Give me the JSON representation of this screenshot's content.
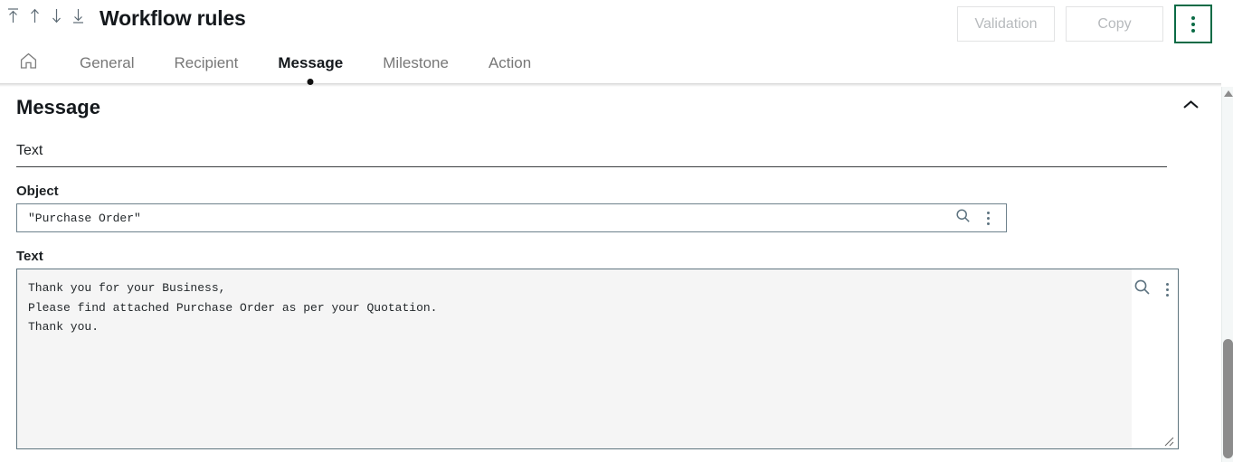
{
  "window": {
    "title": "Workflow rules"
  },
  "record_nav": [
    {
      "name": "first-record",
      "icon": "arrow-up-to-line-icon"
    },
    {
      "name": "previous-record",
      "icon": "arrow-up-icon"
    },
    {
      "name": "next-record",
      "icon": "arrow-down-icon"
    },
    {
      "name": "last-record",
      "icon": "arrow-down-to-line-icon"
    }
  ],
  "toolbar": {
    "validation_label": "Validation",
    "copy_label": "Copy",
    "overflow_icon": "kebab-menu-icon",
    "overflow_accent": "#0b6b46",
    "disabled_text_color": "#b7babd"
  },
  "tabs": {
    "home_icon": "home-icon",
    "items": [
      {
        "label": "General",
        "active": false
      },
      {
        "label": "Recipient",
        "active": false
      },
      {
        "label": "Message",
        "active": true
      },
      {
        "label": "Milestone",
        "active": false
      },
      {
        "label": "Action",
        "active": false
      }
    ]
  },
  "section": {
    "title": "Message",
    "collapse_icon": "chevron-up-icon",
    "expanded": true
  },
  "group": {
    "label": "Text"
  },
  "fields": {
    "object": {
      "label": "Object",
      "value": "\"Purchase Order\"",
      "placeholder": "",
      "search_icon": "search-icon",
      "menu_icon": "kebab-menu-icon"
    },
    "text": {
      "label": "Text",
      "value": "Thank you for your Business,\nPlease find attached Purchase Order as per your Quotation.\nThank you.",
      "placeholder": "",
      "search_icon": "search-icon",
      "menu_icon": "kebab-menu-icon",
      "resize_handle": "resize-grip-icon"
    }
  },
  "scrollbar": {
    "up_arrow_icon": "scroll-up-arrow-icon",
    "thumb": "scroll-thumb"
  }
}
